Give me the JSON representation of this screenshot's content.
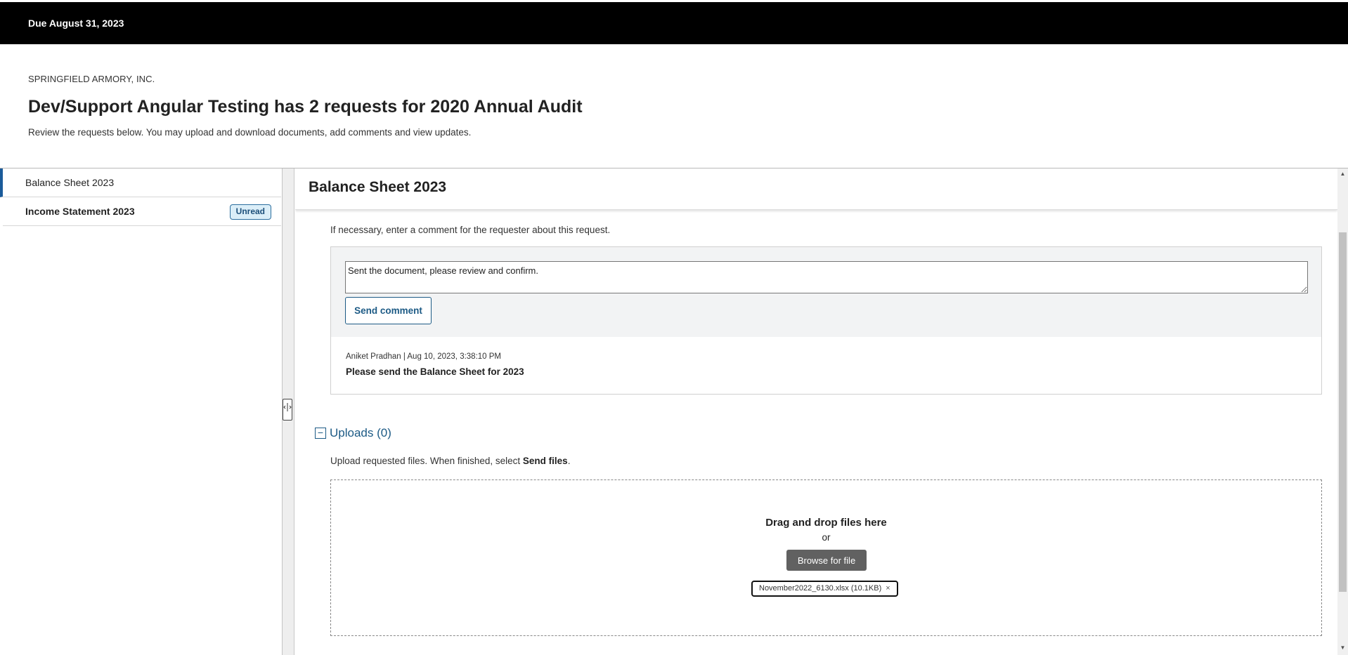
{
  "topbar": {
    "due": "Due August 31, 2023"
  },
  "header": {
    "company": "SPRINGFIELD ARMORY, INC.",
    "title": "Dev/Support Angular Testing has 2 requests for 2020 Annual Audit",
    "subtitle": "Review the requests below. You may upload and download documents, add comments and view updates."
  },
  "sidebar": {
    "items": [
      {
        "label": "Balance Sheet 2023",
        "active": true
      },
      {
        "label": "Income Statement 2023",
        "badge": "Unread"
      }
    ]
  },
  "main": {
    "title": "Balance Sheet 2023",
    "comment_hint": "If necessary, enter a comment for the requester about this request.",
    "comment_value": "Sent the document, please review and confirm.",
    "send_comment_label": "Send comment",
    "comment": {
      "meta": "Aniket Pradhan | Aug 10, 2023, 3:38:10 PM",
      "text": "Please send the Balance Sheet for 2023"
    },
    "uploads": {
      "toggle": "−",
      "title": "Uploads (0)",
      "hint_prefix": "Upload requested files. When finished, select ",
      "hint_bold": "Send files",
      "hint_suffix": ".",
      "drop_title": "Drag and drop files here",
      "drop_or": "or",
      "browse_label": "Browse for file",
      "file_chip": "November2022_6130.xlsx (10.1KB)",
      "file_remove": "×"
    }
  },
  "icons": {
    "splitter": "resize-handle-icon",
    "remove": "close-icon"
  },
  "colors": {
    "accent": "#1c5a85",
    "active_bar": "#1a5b9a",
    "topbar": "#000000"
  }
}
